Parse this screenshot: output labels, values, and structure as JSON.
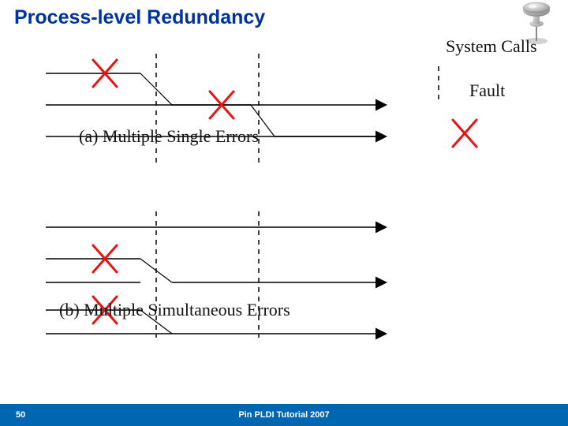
{
  "title": "Process-level Redundancy",
  "captions": {
    "a": "(a) Multiple Single Errors",
    "b": "(b) Multiple Simultaneous Errors"
  },
  "legend": {
    "system_calls": "System Calls",
    "fault": "Fault"
  },
  "footer": {
    "page": "50",
    "text": "Pin PLDI Tutorial 2007"
  }
}
